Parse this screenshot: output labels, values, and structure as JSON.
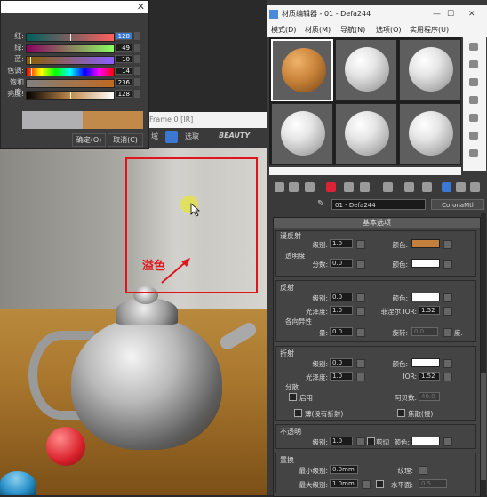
{
  "color_picker": {
    "rows": [
      {
        "label": "红:",
        "value": "128",
        "selected": true,
        "thumb": 0.5,
        "gradient": "linear-gradient(90deg,#005f5f,#ff5f5f)"
      },
      {
        "label": "绿:",
        "value": "49",
        "selected": false,
        "thumb": 0.19,
        "gradient": "linear-gradient(90deg,#8a005f,#8aff5f)"
      },
      {
        "label": "蓝:",
        "value": "10",
        "selected": false,
        "thumb": 0.04,
        "gradient": "linear-gradient(90deg,#8a5f00,#8a5fff)"
      },
      {
        "label": "色调:",
        "value": "14",
        "selected": false,
        "thumb": 0.055,
        "gradient": "linear-gradient(90deg,#f00,#ff0,#0f0,#0ff,#00f,#f0f,#f00)"
      },
      {
        "label": "饱和度:",
        "value": "236",
        "selected": false,
        "thumb": 0.93,
        "gradient": "linear-gradient(90deg,#808080,#c06a20)"
      },
      {
        "label": "亮度:",
        "value": "128",
        "selected": false,
        "thumb": 0.5,
        "gradient": "linear-gradient(90deg,#000,#c28a4a,#fff)"
      }
    ],
    "ok_label": "确定(O)",
    "cancel_label": "取消(C)"
  },
  "render_window": {
    "title_fragment": "Frame 0 [IR]",
    "toolbar_field": "域",
    "toolbar_select": "选取",
    "toolbar_beauty": "BEAUTY"
  },
  "annotation": {
    "label": "溢色",
    "color": "#e0141b"
  },
  "material_editor": {
    "title": "材质编辑器 - 01 - Defa244",
    "menu": [
      "模式(D)",
      "材质(M)",
      "导航(N)",
      "选项(O)",
      "实用程序(U)"
    ],
    "slots": [
      {
        "material": "orange",
        "active": true
      },
      {
        "material": "white"
      },
      {
        "material": "white"
      },
      {
        "material": "white"
      },
      {
        "material": "white"
      },
      {
        "material": "white"
      }
    ],
    "material_name": "01 - Defa244",
    "material_type": "CoronaMtl",
    "rollout_title": "基本选项",
    "diffuse": {
      "title": "漫反射",
      "level_label": "级别:",
      "level": "1.0",
      "color_label": "颜色:",
      "color": "#c2803c",
      "translucency_label": "透明度",
      "fraction_label": "分数:",
      "fraction": "0.0",
      "color2_label": "颜色:"
    },
    "reflection": {
      "title": "反射",
      "level_label": "级别:",
      "level": "0.0",
      "color_label": "颜色:",
      "gloss_label": "光泽度:",
      "gloss": "1.0",
      "fresnel_label": "菲涅尔 IOR:",
      "fresnel": "1.52",
      "aniso_label": "各向异性",
      "amount_label": "量:",
      "amount": "0.0",
      "rotation_label": "旋转:",
      "rotation": "0.0",
      "deg_label": "度."
    },
    "refraction": {
      "title": "折射",
      "level_label": "级别:",
      "level": "0.0",
      "color_label": "颜色:",
      "gloss_label": "光泽度:",
      "gloss": "1.0",
      "ior_label": "IOR:",
      "ior": "1.52",
      "disp_label": "分散",
      "enable_label": "启用",
      "abbe_label": "阿贝数:",
      "abbe": "40.0",
      "thin_label": "薄(没有折射)",
      "caustics_label": "焦散(慢)"
    },
    "opacity": {
      "title": "不透明",
      "level_label": "级别:",
      "level": "1.0",
      "cutout_label": "剪切",
      "color_label": "颜色:"
    },
    "displacement": {
      "title": "置换",
      "min_label": "最小级别:",
      "min": "0.0mm",
      "texture_label": "纹理:",
      "max_label": "最大级别:",
      "max": "1.0mm",
      "water_label": "水平面:",
      "water": "0.5"
    }
  }
}
